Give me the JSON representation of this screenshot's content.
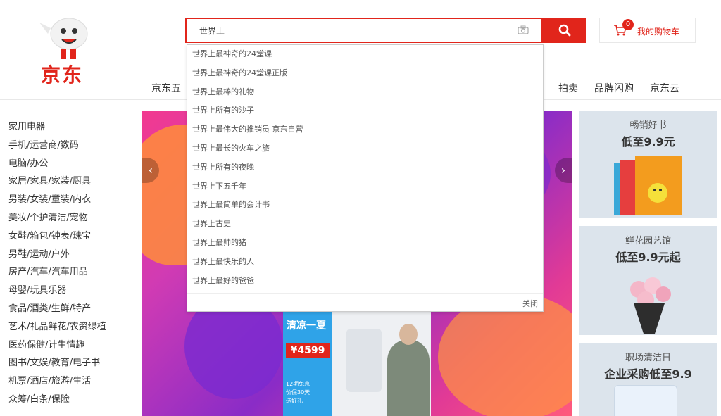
{
  "brand": {
    "logo_text": "京东"
  },
  "search": {
    "value": "世界上",
    "suggestions": [
      "世界上最神奇的24堂课",
      "世界上最神奇的24堂课正版",
      "世界上最棒的礼物",
      "世界上所有的沙子",
      "世界上最伟大的推销员 京东自营",
      "世界上最长的火车之旅",
      "世界上所有的夜晚",
      "世界上下五千年",
      "世界上最简单的会计书",
      "世界上古史",
      "世界上最帅的猪",
      "世界上最快乐的人",
      "世界上最好的爸爸"
    ],
    "close_label": "关闭"
  },
  "cart": {
    "count": "0",
    "label": "我的购物车"
  },
  "nav": {
    "left_partial": "京东五",
    "right_items": [
      "拍卖",
      "品牌闪购",
      "京东云"
    ]
  },
  "categories": [
    "家用电器",
    "手机/运营商/数码",
    "电脑/办公",
    "家居/家具/家装/厨具",
    "男装/女装/童装/内衣",
    "美妆/个护清洁/宠物",
    "女鞋/箱包/钟表/珠宝",
    "男鞋/运动/户外",
    "房产/汽车/汽车用品",
    "母婴/玩具乐器",
    "食品/酒类/生鲜/特产",
    "艺术/礼品鲜花/农资绿植",
    "医药保健/计生情趣",
    "图书/文娱/教育/电子书",
    "机票/酒店/旅游/生活",
    "众筹/白条/保险"
  ],
  "banner": {
    "promo_title": "清凉一夏",
    "promo_price": "¥4599",
    "promo_line1": "12期免息",
    "promo_line2": "价保30天",
    "promo_line3": "送好礼"
  },
  "tiles": [
    {
      "sub": "畅销好书",
      "main": "低至9.9元"
    },
    {
      "sub": "鲜花园艺馆",
      "main": "低至9.9元起"
    },
    {
      "sub": "职场清洁日",
      "main": "企业采购低至9.9"
    }
  ],
  "colors": {
    "brand_red": "#e1251b"
  },
  "icons": [
    "search-icon",
    "camera-icon",
    "cart-icon",
    "chevron-left-icon",
    "chevron-right-icon"
  ]
}
